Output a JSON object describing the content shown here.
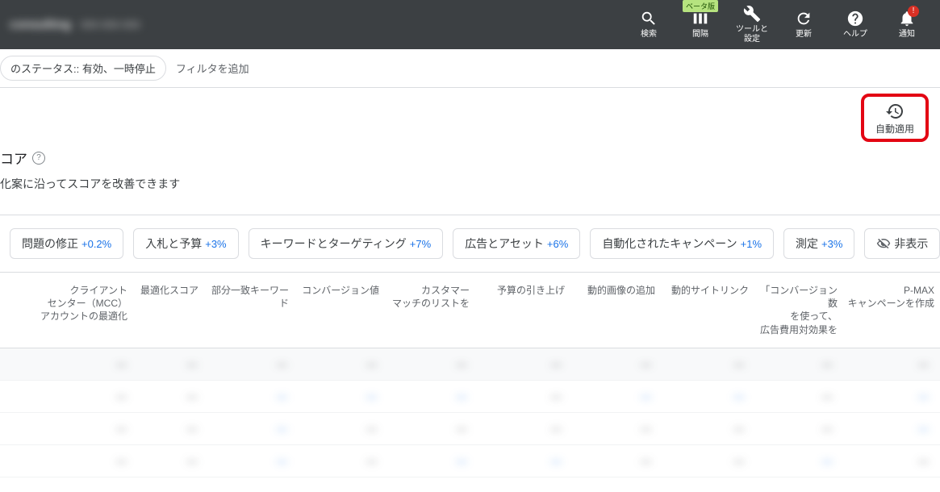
{
  "topbar": {
    "account": "consulting",
    "account_id": "000-000-000",
    "tools": {
      "search": "検索",
      "interval": "間隔",
      "beta": "ベータ版",
      "tools_settings": "ツールと\n設定",
      "refresh": "更新",
      "help": "ヘルプ",
      "notifications": "通知",
      "alert_mark": "!"
    }
  },
  "filterbar": {
    "status_chip": "のステータス:: 有効、一時停止",
    "add_filter": "フィルタを追加"
  },
  "auto_apply": {
    "label": "自動適用"
  },
  "score": {
    "title_suffix": "コア",
    "help_glyph": "?",
    "description": "化案に沿ってスコアを改善できます"
  },
  "categories": [
    {
      "label": "問題の修正",
      "pct": "+0.2%"
    },
    {
      "label": "入札と予算",
      "pct": "+3%"
    },
    {
      "label": "キーワードとターゲティング",
      "pct": "+7%"
    },
    {
      "label": "広告とアセット",
      "pct": "+6%"
    },
    {
      "label": "自動化されたキャンペーン",
      "pct": "+1%"
    },
    {
      "label": "測定",
      "pct": "+3%"
    },
    {
      "label": "非表示",
      "pct": ""
    }
  ],
  "table": {
    "headers": [
      "クライアント\nセンター（MCC）\nアカウントの最適化",
      "最適化スコア",
      "部分一致キーワード",
      "コンバージョン値",
      "カスタマー\nマッチのリストを",
      "予算の引き上げ",
      "動的画像の追加",
      "動的サイトリンク",
      "「コンバージョン数\nを使って、\n広告費用対効果を",
      "P-MAX\nキャンペーンを作成"
    ],
    "rows": [
      [
        "—",
        "—",
        "—",
        "—",
        "—",
        "—",
        "—",
        "—",
        "—",
        "—"
      ],
      [
        "—",
        "—",
        "—",
        "—",
        "—",
        "—",
        "—",
        "—",
        "—",
        "—"
      ],
      [
        "—",
        "—",
        "—",
        "—",
        "—",
        "—",
        "—",
        "—",
        "—",
        "—"
      ],
      [
        "—",
        "—",
        "—",
        "—",
        "—",
        "—",
        "—",
        "—",
        "—",
        "—"
      ]
    ]
  }
}
